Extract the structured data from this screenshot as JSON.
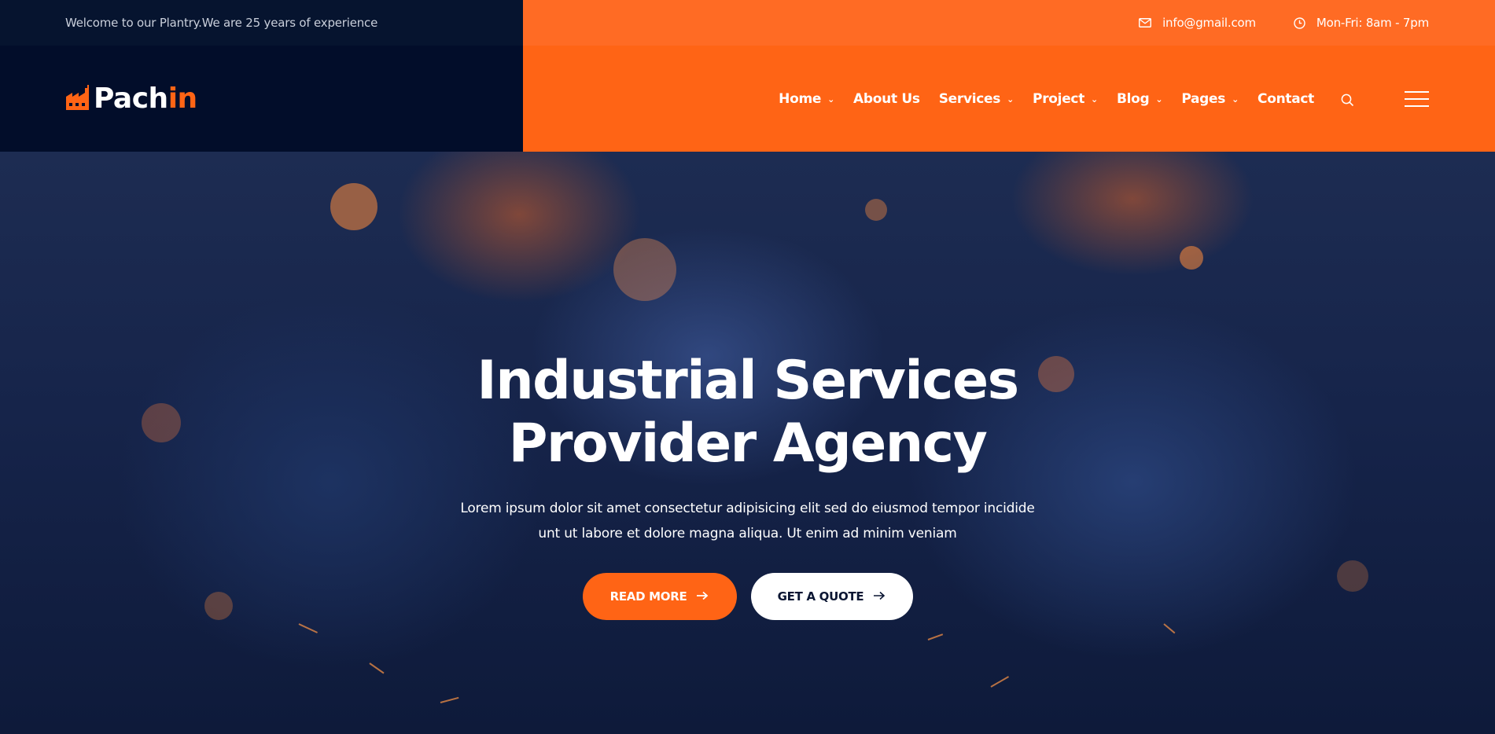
{
  "topbar": {
    "welcome": "Welcome to our Plantry.We are 25 years of experience",
    "email": "info@gmail.com",
    "hours": "Mon-Fri: 8am - 7pm"
  },
  "header": {
    "logo": {
      "main": "Pach",
      "accent": "in"
    },
    "nav": [
      {
        "label": "Home",
        "dropdown": true
      },
      {
        "label": "About Us",
        "dropdown": false
      },
      {
        "label": "Services",
        "dropdown": true
      },
      {
        "label": "Project",
        "dropdown": true
      },
      {
        "label": "Blog",
        "dropdown": true
      },
      {
        "label": "Pages",
        "dropdown": true
      },
      {
        "label": "Contact",
        "dropdown": false
      }
    ]
  },
  "hero": {
    "title_line1": "Industrial Services",
    "title_line2": "Provider Agency",
    "text_line1": "Lorem ipsum dolor sit amet consectetur adipisicing elit sed do eiusmod tempor incidide",
    "text_line2": "unt ut labore et dolore magna aliqua. Ut enim ad minim veniam",
    "primary_button": "READ MORE",
    "secondary_button": "GET A QUOTE"
  },
  "colors": {
    "accent": "#ff6415",
    "dark": "#020d2a",
    "topbar_dark": "#06142f"
  },
  "icons": {
    "email": "envelope-icon",
    "hours": "clock-icon",
    "search": "search-icon",
    "menu": "hamburger-icon",
    "arrow": "arrow-right-icon",
    "logo": "factory-icon"
  }
}
